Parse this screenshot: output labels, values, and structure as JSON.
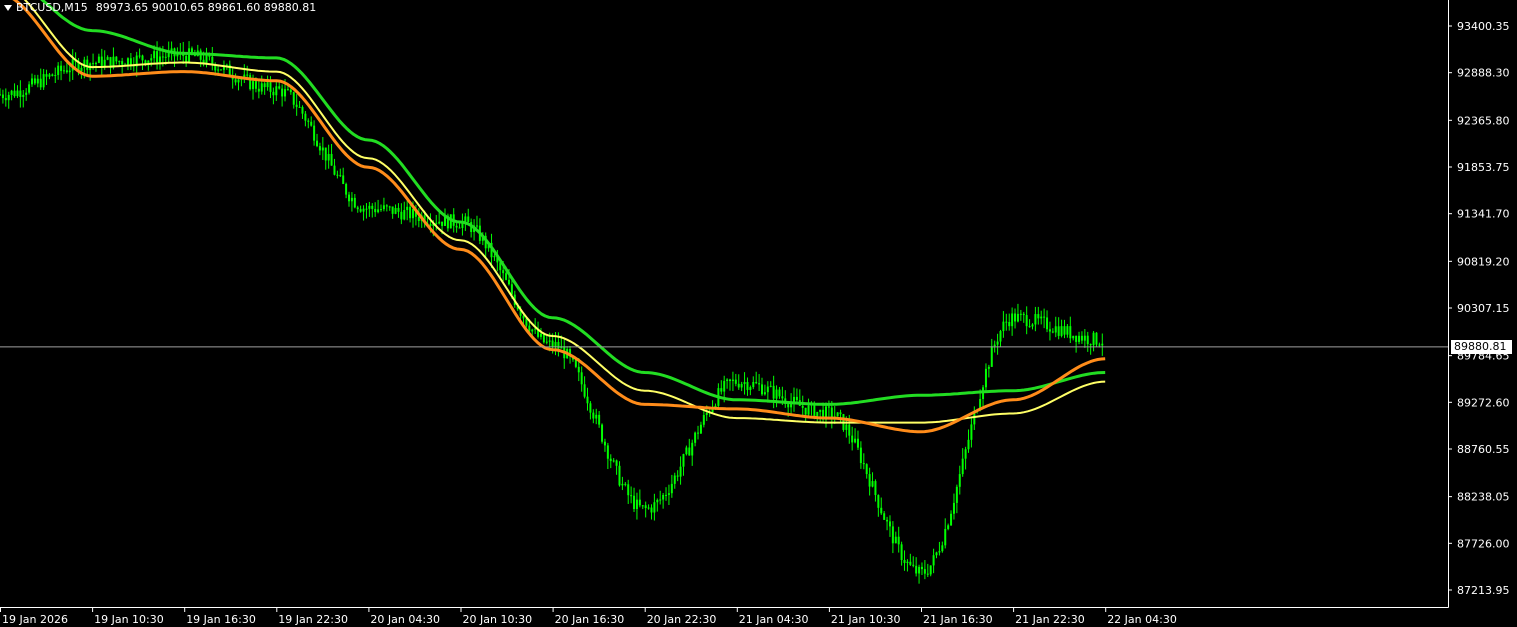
{
  "header": {
    "symbol": "BTCUSD,M15",
    "open": "89973.65",
    "high": "90010.65",
    "low": "89861.60",
    "close": "89880.81"
  },
  "colors": {
    "background": "#000000",
    "axis": "#ffffff",
    "candles": "#00ff00",
    "band_upper": "#22dd22",
    "band_middle": "#ffff66",
    "band_lower": "#ff8c1a",
    "price_line": "#a0a0a0"
  },
  "chart_data": {
    "type": "line",
    "title": "",
    "xlabel": "",
    "ylabel": "",
    "ylim": [
      86900,
      93800
    ],
    "x_ticks": [
      "19 Jan 2026",
      "19 Jan 10:30",
      "19 Jan 16:30",
      "19 Jan 22:30",
      "20 Jan 04:30",
      "20 Jan 10:30",
      "20 Jan 16:30",
      "20 Jan 22:30",
      "21 Jan 04:30",
      "21 Jan 10:30",
      "21 Jan 16:30",
      "21 Jan 22:30",
      "22 Jan 04:30"
    ],
    "y_ticks": [
      "93400.35",
      "92888.30",
      "92365.80",
      "91853.75",
      "91341.70",
      "90819.20",
      "90307.15",
      "89784.65",
      "89272.60",
      "88760.55",
      "88238.05",
      "87726.00",
      "87213.95"
    ],
    "current_price": "89880.81",
    "x_index": [
      0,
      3,
      6,
      9,
      12,
      15,
      18,
      21,
      24,
      27,
      30,
      33,
      36
    ],
    "price_close": [
      92650,
      93000,
      93080,
      92700,
      91400,
      91250,
      89900,
      88100,
      89500,
      89150,
      87400,
      90200,
      89950
    ],
    "series": [
      {
        "values": [
          93950,
          93350,
          93100,
          93050,
          92150,
          91250,
          90200,
          89600,
          89300,
          89250,
          89350,
          89400,
          89600
        ]
      },
      {
        "values": [
          93850,
          92950,
          93000,
          92900,
          91950,
          91050,
          90000,
          89400,
          89100,
          89050,
          89050,
          89150,
          89500
        ]
      },
      {
        "values": [
          93750,
          92850,
          92900,
          92800,
          91850,
          90950,
          89850,
          89250,
          89200,
          89100,
          88950,
          89300,
          89750
        ]
      }
    ]
  }
}
